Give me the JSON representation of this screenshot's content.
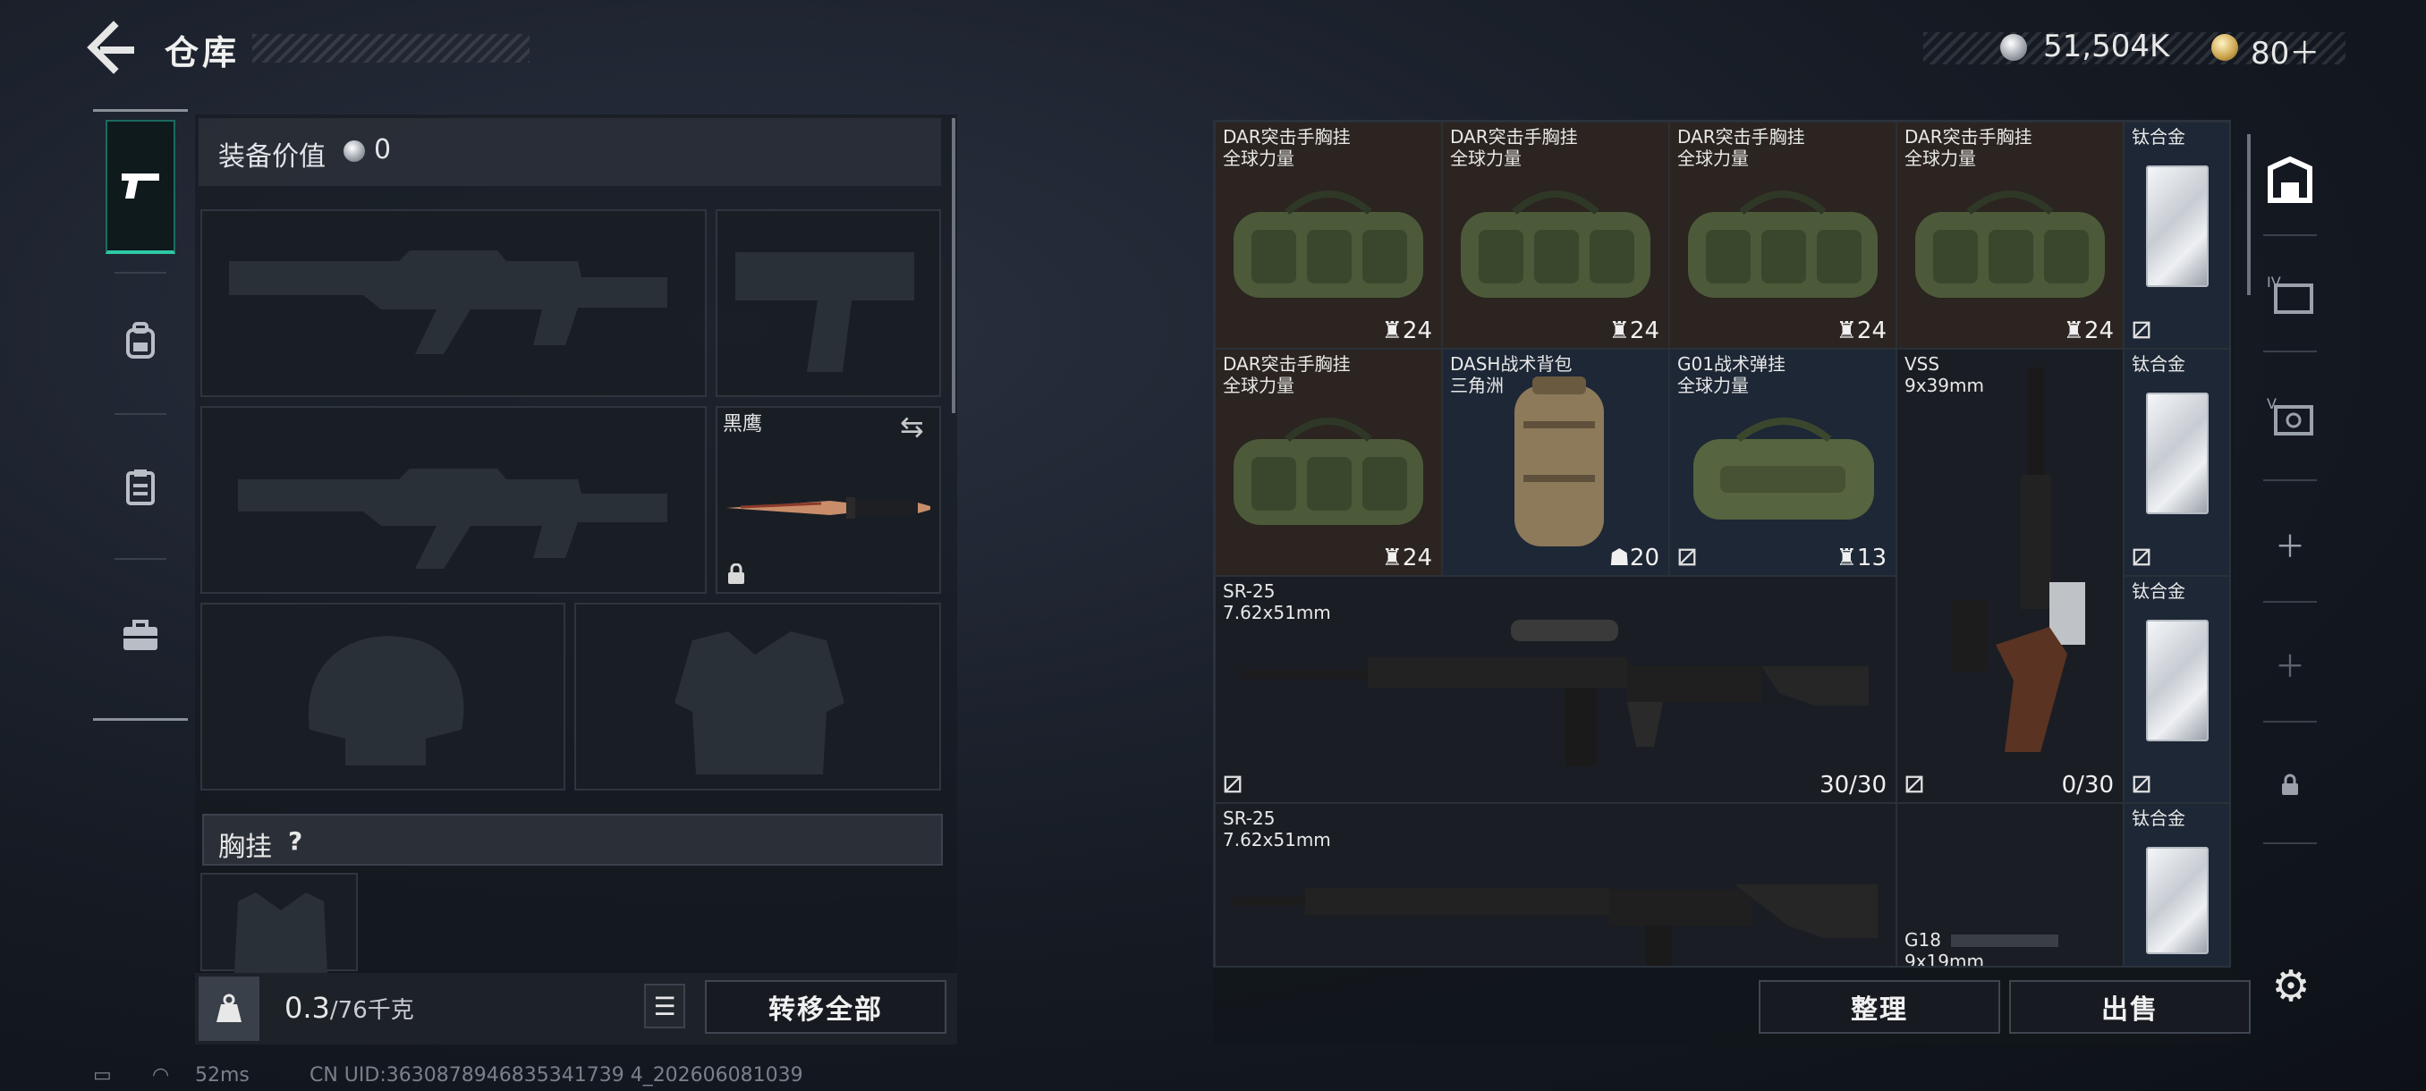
{
  "header": {
    "title": "仓库"
  },
  "currency": {
    "silver": "51,504K",
    "gold": "80＋"
  },
  "loadout": {
    "value_label": "装备价值",
    "value": "0",
    "knife_name": "黑鹰",
    "chest_label": "胸挂",
    "help": "?"
  },
  "footer": {
    "weight_current": "0.3",
    "weight_capacity": "/76千克",
    "transfer_all": "转移全部",
    "organize": "整理",
    "sell": "出售"
  },
  "status": {
    "ping": "52ms",
    "uid": "CN UID:3630878946835341739 4_202606081039"
  },
  "storage": {
    "items": [
      {
        "name": "DAR突击手胸挂",
        "sub": "全球力量",
        "count": "24"
      },
      {
        "name": "DAR突击手胸挂",
        "sub": "全球力量",
        "count": "24"
      },
      {
        "name": "DAR突击手胸挂",
        "sub": "全球力量",
        "count": "24"
      },
      {
        "name": "DAR突击手胸挂",
        "sub": "全球力量",
        "count": "24"
      },
      {
        "name": "DAR突击手胸挂",
        "sub": "全球力量",
        "count": "24"
      },
      {
        "name": "DASH战术背包",
        "sub": "三角洲",
        "count": "20"
      },
      {
        "name": "G01战术弹挂",
        "sub": "全球力量",
        "count": "13"
      },
      {
        "name": "VSS",
        "sub": "9x39mm",
        "count": "0/30"
      },
      {
        "name": "SR-25",
        "sub": "7.62x51mm",
        "count": "30/30"
      },
      {
        "name": "SR-25",
        "sub": "7.62x51mm",
        "count": ""
      },
      {
        "name": "G18",
        "sub": "9x19mm",
        "count": ""
      }
    ],
    "ingot_label": "钛合金"
  },
  "icons": {
    "back": "back-arrow-icon",
    "nav": [
      "pistol-icon",
      "backpack-icon",
      "chest-rig-icon",
      "case-icon"
    ],
    "rail": [
      "stash-icon",
      "tab-4-icon",
      "tab-5-icon",
      "add-icon",
      "add-icon",
      "lock-icon"
    ],
    "settings": "gear-icon"
  },
  "colors": {
    "accent_green": "#2ec9a4",
    "gold": "#c9a24a"
  }
}
